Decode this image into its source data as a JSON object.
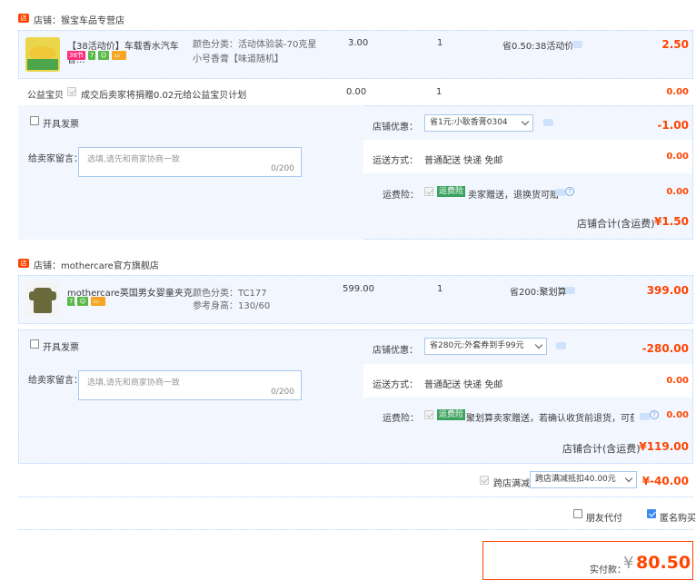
{
  "shop1": {
    "name": "店铺：猴宝车品专营店",
    "item": {
      "title": "【38活动价】车载香水汽车香...",
      "badge_event": "38节",
      "badge_seven": "7",
      "sku": "颜色分类：活动体验装-70克星小号香膏【味道随机】",
      "price": "3.00",
      "qty": "1",
      "promo": "省0.50:38活动价",
      "subtotal": "2.50"
    },
    "charity": {
      "label": "公益宝贝",
      "text": "成交后卖家将捐赠0.02元给公益宝贝计划",
      "price": "0.00",
      "qty": "1",
      "subtotal": "0.00"
    },
    "invoice_label": "开具发票",
    "message_label": "给卖家留言：",
    "message_placeholder": "选填,请先和商家协商一致",
    "message_count": "0/200",
    "coupon_label": "店铺优惠：",
    "coupon_value": "省1元:小耿香膏0304",
    "coupon_amount": "-1.00",
    "shipping_label": "运送方式：",
    "shipping_value": "普通配送 快递 免邮",
    "shipping_amount": "0.00",
    "insurance_label": "运费险：",
    "insurance_tag": "运费险",
    "insurance_text": "卖家赠送，退换货可赔",
    "insurance_amount": "0.00",
    "total_label": "店铺合计(含运费)",
    "total_value": "¥1.50"
  },
  "shop2": {
    "name": "店铺：mothercare官方旗舰店",
    "item": {
      "title": "mothercare英国男女婴童夹克 ...",
      "badge_seven": "7",
      "sku1": "颜色分类：TC177",
      "sku2": "参考身高：130/60",
      "price": "599.00",
      "qty": "1",
      "promo": "省200:聚划算",
      "subtotal": "399.00"
    },
    "invoice_label": "开具发票",
    "message_label": "给卖家留言：",
    "message_placeholder": "选填,请先和商家协商一致",
    "message_count": "0/200",
    "coupon_label": "店铺优惠：",
    "coupon_value": "省280元:外套券到手99元",
    "coupon_amount": "-280.00",
    "shipping_label": "运送方式：",
    "shipping_value": "普通配送 快递 免邮",
    "shipping_amount": "0.00",
    "insurance_label": "运费险：",
    "insurance_tag": "运费险",
    "insurance_text": "聚划算卖家赠送，若确认收货前退货，可获...",
    "insurance_amount": "0.00",
    "total_label": "店铺合计(含运费)",
    "total_value": "¥119.00"
  },
  "cross_store": {
    "label": "跨店满减",
    "select": "跨店满减抵扣40.00元",
    "amount": "¥-40.00"
  },
  "options": {
    "friend_pay": "朋友代付",
    "anonymous": "匿名购买"
  },
  "payment": {
    "label": "实付款：",
    "currency": "¥",
    "amount": "80.50"
  },
  "colors": {
    "accent": "#ff4400",
    "border": "#b2d1ff",
    "row_bg": "#f2f7ff"
  }
}
